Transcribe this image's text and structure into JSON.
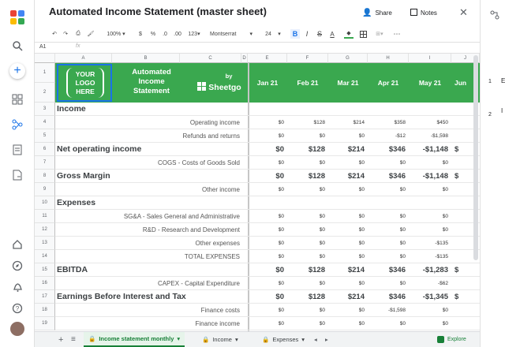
{
  "app": {
    "title": "Automated Income Statement (master sheet)",
    "share_label": "Share",
    "notes_label": "Notes"
  },
  "toolbar": {
    "zoom": "100%",
    "currency": "$",
    "percent": "%",
    "dec_less": ".0",
    "dec_more": ".00",
    "format_num": "123",
    "font": "Montserrat",
    "font_size": "24",
    "bold": "B",
    "italic": "I",
    "strike": "S",
    "text_color": "A"
  },
  "formula_bar": {
    "cell_ref": "A1",
    "fx": "fx"
  },
  "columns": [
    "A",
    "B",
    "C",
    "D",
    "E",
    "F",
    "G",
    "H",
    "I",
    "J"
  ],
  "header": {
    "logo_line1": "YOUR",
    "logo_line2": "LOGO",
    "logo_line3": "HERE",
    "title_line1": "Automated",
    "title_line2": "Income",
    "title_line3": "Statement",
    "by": "by",
    "brand": "Sheetgo",
    "months": [
      "Jan 21",
      "Feb 21",
      "Mar 21",
      "Apr 21",
      "May 21",
      "Jun"
    ]
  },
  "rows": [
    {
      "n": "3",
      "label": "Income",
      "bold": true,
      "values": [
        "",
        "",
        "",
        "",
        "",
        ""
      ]
    },
    {
      "n": "4",
      "label": "Operating income",
      "bold": false,
      "values": [
        "$0",
        "$128",
        "$214",
        "$358",
        "$450",
        ""
      ]
    },
    {
      "n": "5",
      "label": "Refunds and returns",
      "bold": false,
      "values": [
        "$0",
        "$0",
        "$0",
        "-$12",
        "-$1,598",
        ""
      ]
    },
    {
      "n": "6",
      "label": "Net operating income",
      "bold": true,
      "values": [
        "$0",
        "$128",
        "$214",
        "$346",
        "-$1,148",
        "$"
      ]
    },
    {
      "n": "7",
      "label": "COGS - Costs of Goods Sold",
      "bold": false,
      "values": [
        "$0",
        "$0",
        "$0",
        "$0",
        "$0",
        ""
      ]
    },
    {
      "n": "8",
      "label": "Gross Margin",
      "bold": true,
      "values": [
        "$0",
        "$128",
        "$214",
        "$346",
        "-$1,148",
        "$"
      ]
    },
    {
      "n": "9",
      "label": "Other income",
      "bold": false,
      "values": [
        "$0",
        "$0",
        "$0",
        "$0",
        "$0",
        ""
      ]
    },
    {
      "n": "10",
      "label": "Expenses",
      "bold": true,
      "values": [
        "",
        "",
        "",
        "",
        "",
        ""
      ]
    },
    {
      "n": "11",
      "label": "SG&A - Sales General and Administrative",
      "bold": false,
      "values": [
        "$0",
        "$0",
        "$0",
        "$0",
        "$0",
        ""
      ]
    },
    {
      "n": "12",
      "label": "R&D - Research and Development",
      "bold": false,
      "values": [
        "$0",
        "$0",
        "$0",
        "$0",
        "$0",
        ""
      ]
    },
    {
      "n": "13",
      "label": "Other expenses",
      "bold": false,
      "values": [
        "$0",
        "$0",
        "$0",
        "$0",
        "-$135",
        ""
      ]
    },
    {
      "n": "14",
      "label": "TOTAL EXPENSES",
      "bold": false,
      "values": [
        "$0",
        "$0",
        "$0",
        "$0",
        "-$135",
        ""
      ]
    },
    {
      "n": "15",
      "label": "EBITDA",
      "bold": true,
      "values": [
        "$0",
        "$128",
        "$214",
        "$346",
        "-$1,283",
        "$"
      ]
    },
    {
      "n": "16",
      "label": "CAPEX - Capital Expenditure",
      "bold": false,
      "values": [
        "$0",
        "$0",
        "$0",
        "$0",
        "-$62",
        ""
      ]
    },
    {
      "n": "17",
      "label": "Earnings Before Interest and Tax",
      "bold": true,
      "values": [
        "$0",
        "$128",
        "$214",
        "$346",
        "-$1,345",
        "$"
      ]
    },
    {
      "n": "18",
      "label": "Finance costs",
      "bold": false,
      "values": [
        "$0",
        "$0",
        "$0",
        "-$1,598",
        "$0",
        ""
      ]
    },
    {
      "n": "19",
      "label": "Finance income",
      "bold": false,
      "values": [
        "$0",
        "$0",
        "$0",
        "$0",
        "$0",
        ""
      ]
    }
  ],
  "tabs": [
    {
      "label": "Income statement monthly",
      "active": true
    },
    {
      "label": "Income",
      "active": false
    },
    {
      "label": "Expenses",
      "active": false
    }
  ],
  "explore_label": "Explore",
  "right_panel": {
    "items": [
      "1",
      "2"
    ],
    "item_letters": [
      "E",
      "I"
    ]
  },
  "colors": {
    "green": "#3aa84f",
    "accent": "#1a73e8"
  }
}
